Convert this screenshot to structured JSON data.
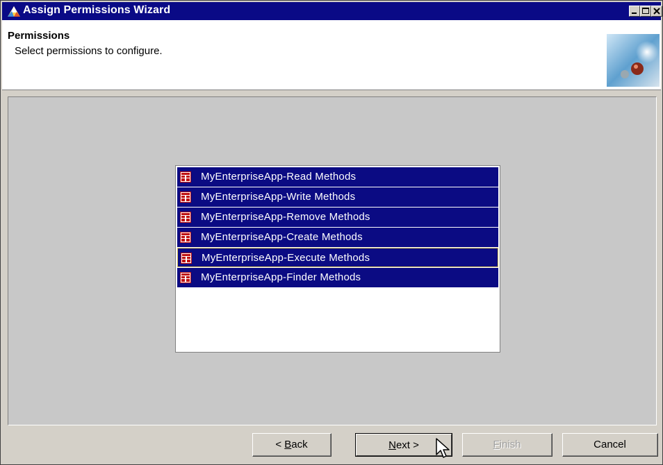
{
  "window": {
    "title": "Assign Permissions Wizard",
    "controls": [
      "minimize-icon",
      "maximize-icon",
      "close-icon"
    ]
  },
  "header": {
    "title": "Permissions",
    "subtitle": "Select permissions to configure."
  },
  "permissions": {
    "items": [
      {
        "label": "MyEnterpriseApp-Read Methods",
        "selected": true,
        "focused": false
      },
      {
        "label": "MyEnterpriseApp-Write Methods",
        "selected": true,
        "focused": false
      },
      {
        "label": "MyEnterpriseApp-Remove Methods",
        "selected": true,
        "focused": false
      },
      {
        "label": "MyEnterpriseApp-Create Methods",
        "selected": true,
        "focused": false
      },
      {
        "label": "MyEnterpriseApp-Execute Methods",
        "selected": true,
        "focused": true
      },
      {
        "label": "MyEnterpriseApp-Finder Methods",
        "selected": true,
        "focused": false
      }
    ],
    "icon": "permission-list-icon"
  },
  "buttons": {
    "back": {
      "label_pre": "< ",
      "mnemonic": "B",
      "label_post": "ack"
    },
    "next": {
      "label_pre": "",
      "mnemonic": "N",
      "label_post": "ext >"
    },
    "finish": {
      "label_pre": "",
      "mnemonic": "F",
      "label_post": "inish",
      "enabled": false
    },
    "cancel": {
      "label": "Cancel"
    }
  },
  "colors": {
    "title_bar": "#0a0a86",
    "selection": "#0b0b83",
    "focus_border": "#d6c25a"
  }
}
